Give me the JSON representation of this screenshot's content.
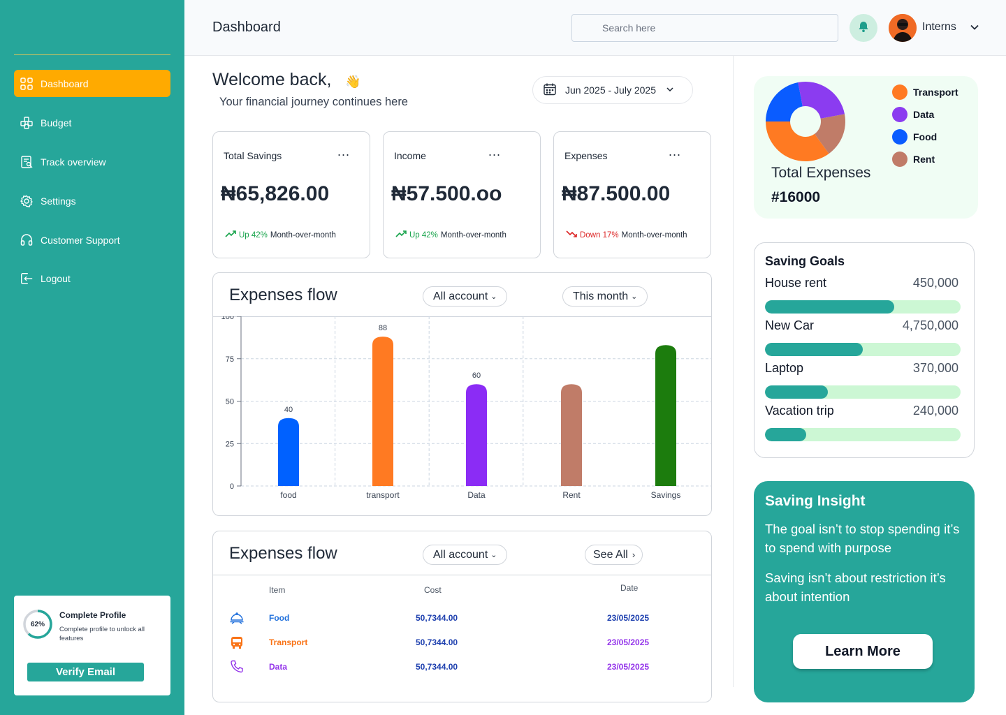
{
  "sidebar": {
    "items": [
      {
        "label": "Dashboard",
        "icon": "grid-icon",
        "active": true
      },
      {
        "label": "Budget",
        "icon": "boxes-icon"
      },
      {
        "label": "Track overview",
        "icon": "report-icon"
      },
      {
        "label": "Settings",
        "icon": "gear-icon"
      },
      {
        "label": "Customer Support",
        "icon": "headset-icon"
      },
      {
        "label": "Logout",
        "icon": "logout-icon"
      }
    ],
    "profile": {
      "percent": "62%",
      "progress": 0.62,
      "title": "Complete Profile",
      "subtitle": "Complete profile to unlock all features",
      "button": "Verify Email"
    }
  },
  "header": {
    "title": "Dashboard",
    "search_placeholder": "Search here",
    "user_name": "Interns"
  },
  "welcome": {
    "title": "Welcome back,",
    "emoji": "👋",
    "subtitle": "Your financial journey continues here",
    "date_range": "Jun 2025 - July 2025"
  },
  "stats": [
    {
      "label": "Total Savings",
      "menu": "...",
      "value": "₦65,826.00",
      "change": "Up 42%",
      "direction": "up",
      "period": "Month-over-month"
    },
    {
      "label": "Income",
      "menu": "...",
      "value": "₦57.500.oo",
      "change": "Up 42%",
      "direction": "up",
      "period": "Month-over-month"
    },
    {
      "label": "Expenses",
      "menu": "...",
      "value": "₦87.500.00",
      "change": "Down 17%",
      "direction": "down",
      "period": "Month-over-month"
    }
  ],
  "expenses_chart": {
    "title": "Expenses flow",
    "filter_account": "All account",
    "filter_period": "This month"
  },
  "chart_data": {
    "type": "bar",
    "categories": [
      "food",
      "transport",
      "Data",
      "Rent",
      "Savings"
    ],
    "values": [
      40,
      88,
      60,
      60,
      83
    ],
    "data_labels": [
      "40",
      "88",
      "60",
      "",
      ""
    ],
    "colors": [
      "#0061ff",
      "#ff7a22",
      "#8b2cf5",
      "#c07c68",
      "#1c7c0d"
    ],
    "ylim": [
      0,
      100
    ],
    "yticks": [
      "0",
      "25",
      "50",
      "75",
      "100"
    ],
    "grid": true
  },
  "expenses_table": {
    "title": "Expenses flow",
    "filter_account": "All account",
    "see_all": "See All",
    "columns": [
      "Item",
      "Cost",
      "Date"
    ],
    "rows": [
      {
        "item": "Food",
        "cost": "50,7344.00",
        "date": "23/05/2025",
        "color": "#1e6fdc",
        "icon": "food-cover-icon"
      },
      {
        "item": "Transport",
        "cost": "50,7344.00",
        "date": "23/05/2025",
        "color": "#f97316",
        "icon": "bus-icon"
      },
      {
        "item": "Data",
        "cost": "50,7344.00",
        "date": "23/05/2025",
        "color": "#9333ea",
        "icon": "phone-icon"
      }
    ],
    "cost_color": "#1e40af"
  },
  "donut": {
    "total_label": "Total Expenses",
    "total_value": "#16000",
    "slices": [
      {
        "name": "Transport",
        "color": "#ff7a22",
        "value": 35
      },
      {
        "name": "Data",
        "color": "#8b3cf0",
        "value": 25
      },
      {
        "name": "Food",
        "color": "#0a5cff",
        "value": 22
      },
      {
        "name": "Rent",
        "color": "#c07c68",
        "value": 18
      }
    ]
  },
  "saving_goals": {
    "title": "Saving Goals",
    "items": [
      {
        "name": "House rent",
        "amount": "450,000",
        "progress": 0.66
      },
      {
        "name": "New Car",
        "amount": "4,750,000",
        "progress": 0.5
      },
      {
        "name": "Laptop",
        "amount": "370,000",
        "progress": 0.32
      },
      {
        "name": "Vacation trip",
        "amount": "240,000",
        "progress": 0.21
      }
    ]
  },
  "insight": {
    "title": "Saving Insight",
    "p1": "The goal isn’t to stop spending it’s to spend with purpose",
    "p2": "Saving isn’t about restriction  it’s about intention",
    "button": "Learn More"
  }
}
